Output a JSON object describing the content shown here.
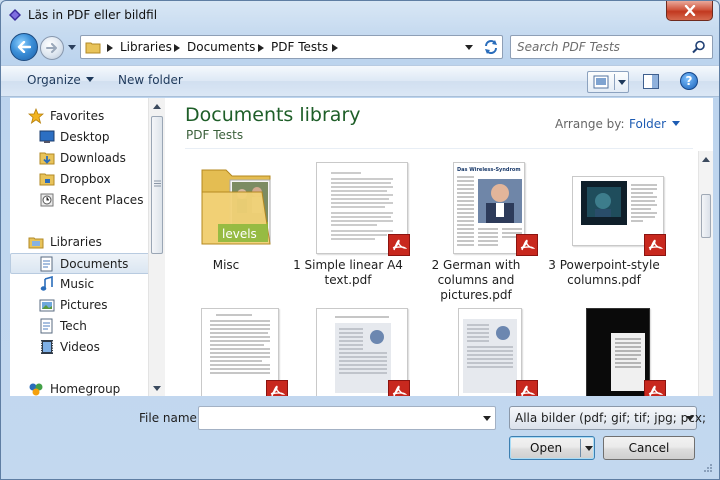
{
  "window": {
    "title": "Läs in PDF eller bildfil"
  },
  "address": {
    "crumbs": [
      "Libraries",
      "Documents",
      "PDF Tests"
    ]
  },
  "search": {
    "placeholder": "Search PDF Tests"
  },
  "toolbar": {
    "organize": "Organize",
    "new_folder": "New folder"
  },
  "nav": {
    "favorites_label": "Favorites",
    "favorites": [
      "Desktop",
      "Downloads",
      "Dropbox",
      "Recent Places"
    ],
    "libraries_label": "Libraries",
    "libraries": [
      "Documents",
      "Music",
      "Pictures",
      "Tech",
      "Videos"
    ],
    "homegroup": "Homegroup",
    "selected": "Documents"
  },
  "main": {
    "title": "Documents library",
    "subtitle": "PDF Tests",
    "arrange_label": "Arrange by:",
    "arrange_value": "Folder",
    "items": [
      {
        "name": "Misc",
        "type": "folder"
      },
      {
        "name": "1 Simple linear A4 text.pdf",
        "type": "pdf"
      },
      {
        "name": "2 German with columns and pictures.pdf",
        "type": "pdf"
      },
      {
        "name": "3 Powerpoint-style columns.pdf",
        "type": "pdf"
      },
      {
        "name": "",
        "type": "pdf"
      },
      {
        "name": "",
        "type": "pdf"
      },
      {
        "name": "",
        "type": "pdf"
      },
      {
        "name": "",
        "type": "pdf"
      }
    ],
    "thumb_texts": {
      "folder_photo": "levels",
      "german_header": "Das Wireless-Syndrom"
    }
  },
  "bottom": {
    "file_name_label": "File name:",
    "file_name_value": "",
    "filter": "Alla bilder (pdf; gif; tif; jpg; pcx;",
    "open": "Open",
    "cancel": "Cancel"
  },
  "colors": {
    "accent": "#1e5e28",
    "pdf_red": "#c8281e",
    "link_blue": "#1e5cb3"
  }
}
